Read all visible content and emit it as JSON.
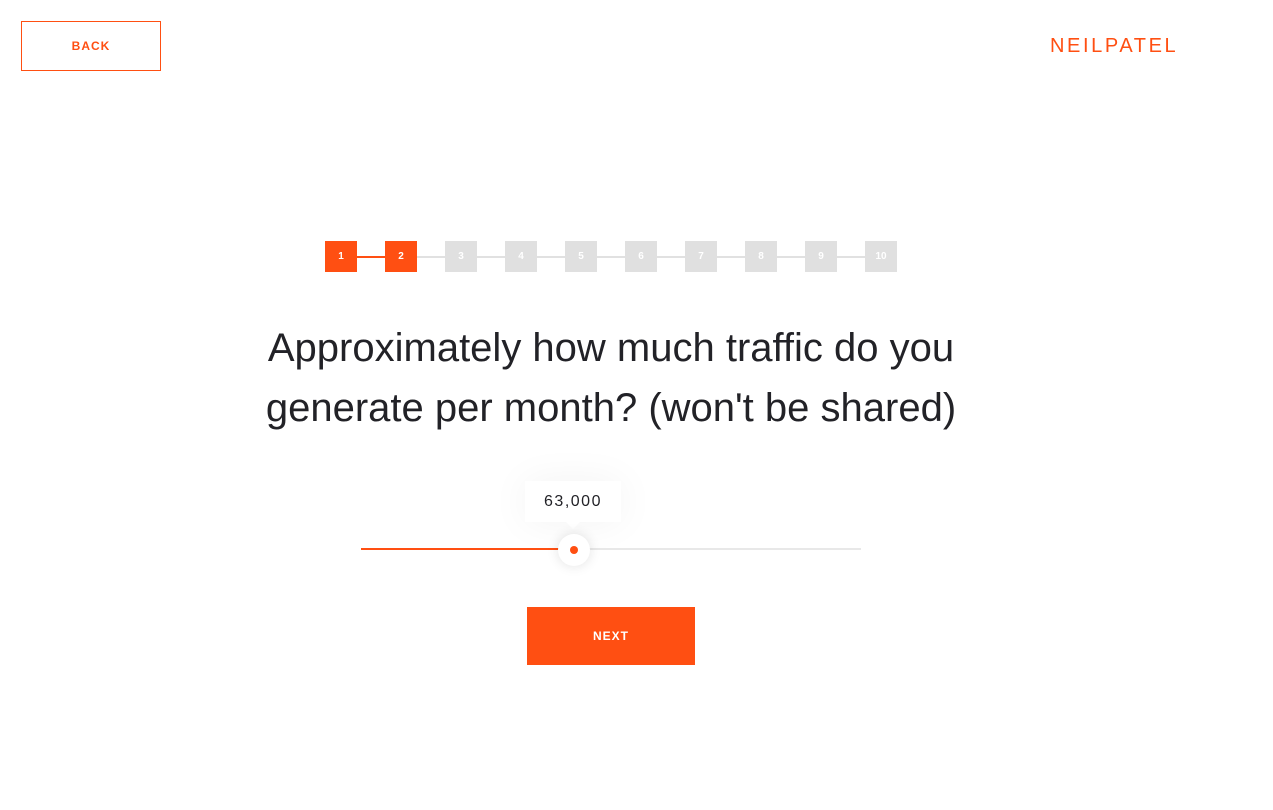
{
  "header": {
    "back_label": "BACK",
    "logo_text": "NEILPATEL"
  },
  "progress": {
    "current_step": 2,
    "steps": [
      "1",
      "2",
      "3",
      "4",
      "5",
      "6",
      "7",
      "8",
      "9",
      "10"
    ]
  },
  "question": {
    "text": "Approximately how much traffic do you generate per month? (won't be shared)"
  },
  "slider": {
    "value_label": "63,000",
    "fill_fraction": 0.425
  },
  "actions": {
    "next_label": "NEXT"
  },
  "colors": {
    "accent": "#ff4f12",
    "inactive_step": "#e0e0e0",
    "text": "#222227"
  }
}
